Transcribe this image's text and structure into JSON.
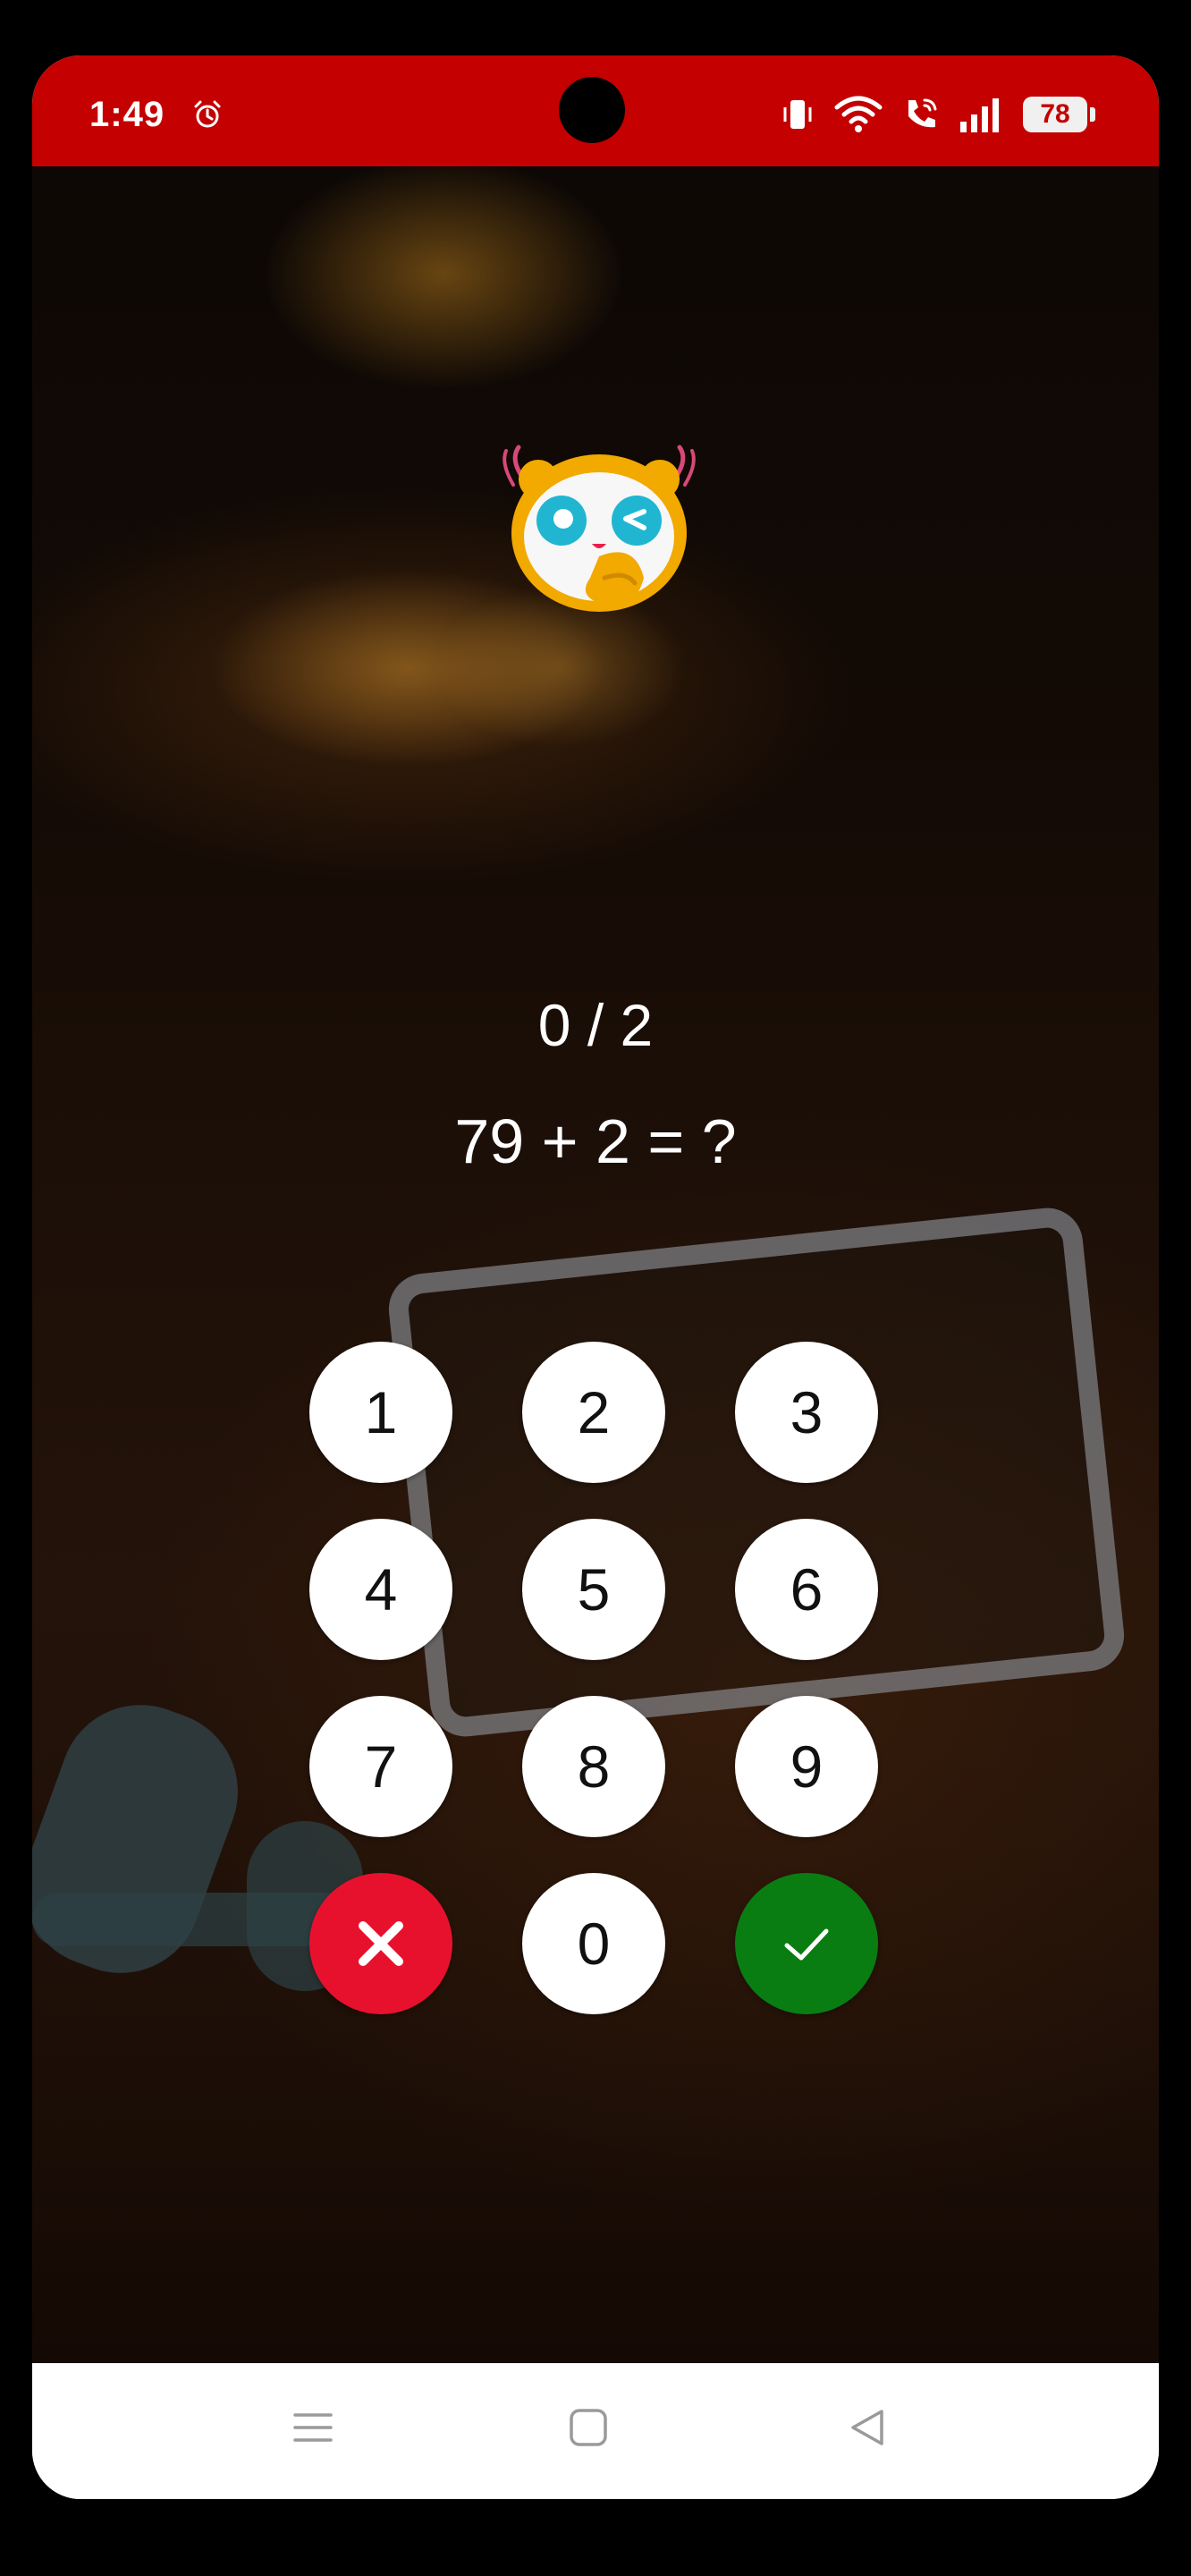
{
  "status_bar": {
    "time": "1:49",
    "battery": "78",
    "icons": [
      "alarm-icon",
      "vibrate-icon",
      "wifi-icon",
      "wifi-calling-icon",
      "signal-icon",
      "battery-icon"
    ],
    "background_color": "#c40000"
  },
  "challenge": {
    "progress": "0 / 2",
    "question": "79 + 2 = ?",
    "mascot_icon": "panda-face-icon"
  },
  "keypad": {
    "keys": [
      "1",
      "2",
      "3",
      "4",
      "5",
      "6",
      "7",
      "8",
      "9",
      "0"
    ],
    "clear_icon": "close-icon",
    "confirm_icon": "checkmark-icon",
    "clear_color": "#e8112d",
    "confirm_color": "#0a7d12"
  },
  "nav_bar": {
    "icons": [
      "menu-icon",
      "home-icon",
      "back-icon"
    ]
  }
}
